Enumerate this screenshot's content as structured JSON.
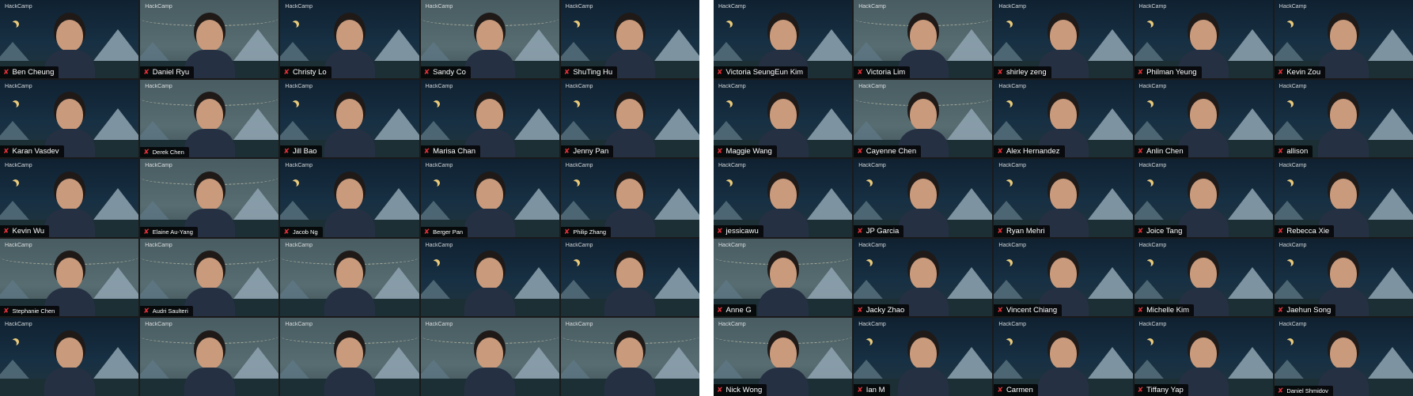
{
  "meeting": {
    "brand_label": "HackCamp",
    "mic_icon": "muted-mic-icon",
    "left_participants": [
      "Ben Cheung",
      "Daniel Ryu",
      "Christy Lo",
      "Sandy Co",
      "ShuTing Hu",
      "Karan Vasdev",
      "Derek Chen",
      "Jill Bao",
      "Marisa Chan",
      "Jenny Pan",
      "Kevin Wu",
      "Elaine Au-Yang",
      "Jacob Ng",
      "Berger Pan",
      "Philip Zhang",
      "Stephanie Chen",
      "Audri Saulteri",
      "",
      "",
      "",
      "",
      "",
      "",
      "",
      ""
    ],
    "right_participants": [
      "Victoria SeungEun Kim",
      "Victoria Lim",
      "shirley zeng",
      "Philman Yeung",
      "Kevin Zou",
      "Maggie Wang",
      "Cayenne Chen",
      "Alex Hernandez",
      "Anlin Chen",
      "allison",
      "jessicawu",
      "JP Garcia",
      "Ryan Mehri",
      "Joice Tang",
      "Rebecca Xie",
      "Anne G",
      "Jacky Zhao",
      "Vincent Chiang",
      "Michelle Kim",
      "Jaehun Song",
      "Nick Wong",
      "Ian M",
      "Carmen",
      "Tiffany Yap",
      "Daniel Shmidov"
    ],
    "colors": {
      "mic_muted": "#e5323a",
      "nameplate_bg": "#000000",
      "separator": "#ffffff"
    }
  }
}
